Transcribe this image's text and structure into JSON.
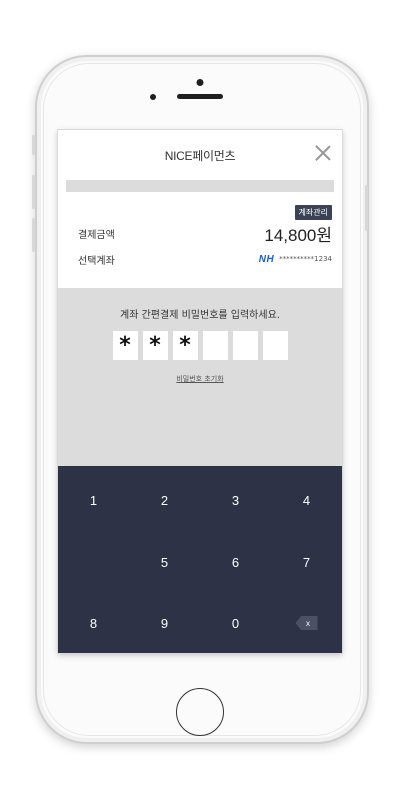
{
  "header": {
    "title": "NICE페이먼츠"
  },
  "manage_button": "계좌관리",
  "payment": {
    "amount_label": "결제금액",
    "amount_value": "14,800원",
    "account_label": "선택계좌",
    "bank_logo": "NH",
    "account_number": "**********1234"
  },
  "pin": {
    "prompt": "계좌 간편결제 비밀번호를 입력하세요.",
    "boxes": [
      "*",
      "*",
      "*",
      "",
      "",
      ""
    ],
    "reset_link": "비밀번호 초기화"
  },
  "keypad": {
    "keys": [
      "1",
      "2",
      "3",
      "4",
      "",
      "5",
      "6",
      "7",
      "8",
      "9",
      "0"
    ],
    "backspace": "x"
  },
  "colors": {
    "keypad_bg": "#2d3247",
    "manage_btn_bg": "#3b4256",
    "pin_area_bg": "#dcdcdc",
    "bank_logo": "#1f5fbf"
  },
  "icons": {
    "close": "close-icon",
    "backspace": "backspace-icon",
    "home": "home-button-icon"
  }
}
